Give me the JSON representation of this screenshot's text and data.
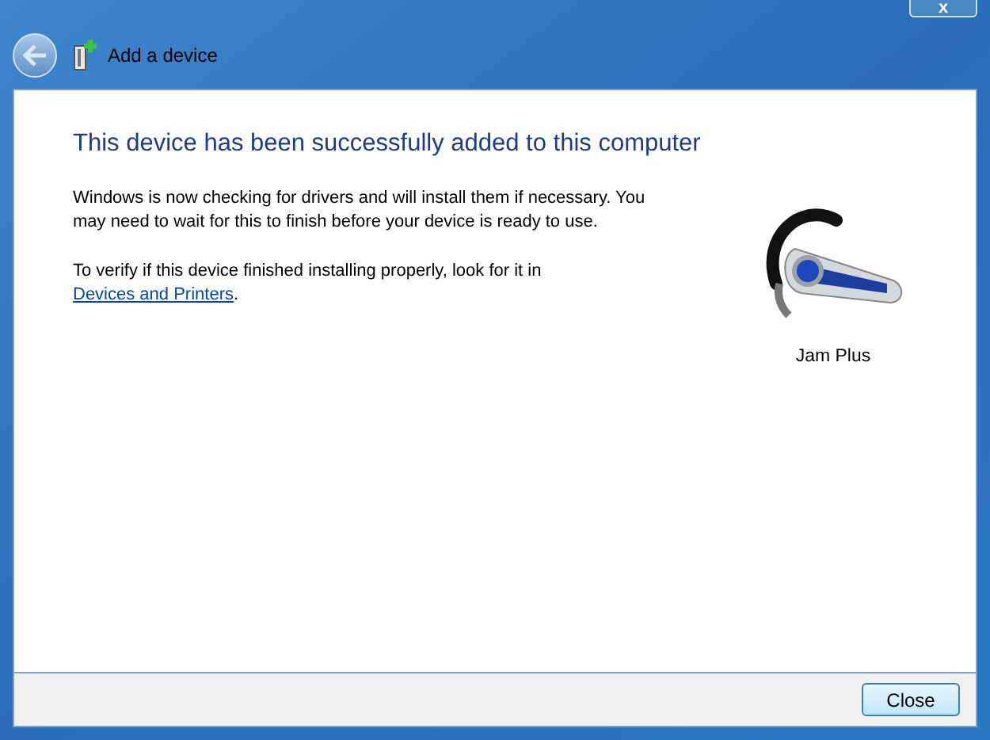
{
  "window": {
    "close_label": "x"
  },
  "toolbar": {
    "title": "Add a device"
  },
  "content": {
    "heading": "This device has been successfully added to this computer",
    "paragraphs": [
      {
        "text": "Windows is now checking for drivers and will install them if necessary. You may need to wait for this to finish before your device is ready to use."
      },
      {
        "text": "To verify if this device finished installing properly, look for it in",
        "link": "Devices and Printers",
        "after": "."
      }
    ],
    "device": {
      "name": "Jam Plus"
    }
  },
  "footer": {
    "buttons": [
      "Close"
    ]
  }
}
